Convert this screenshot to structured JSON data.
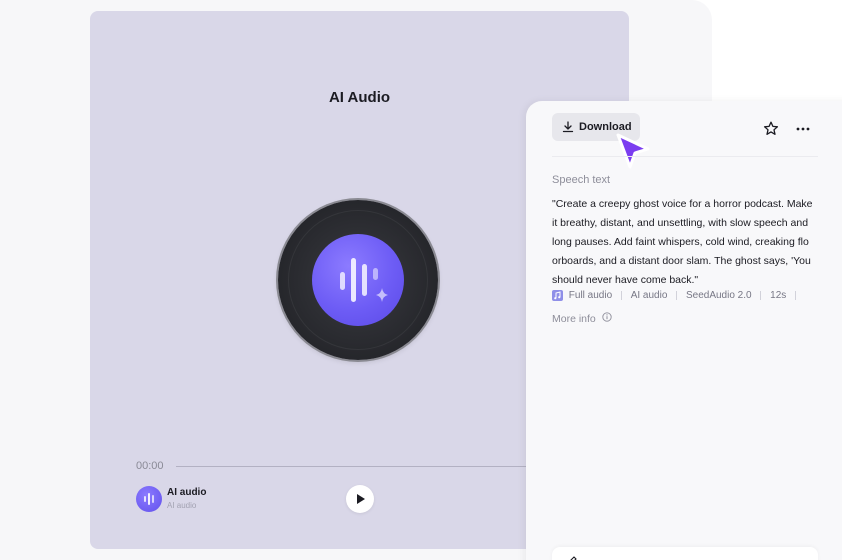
{
  "player": {
    "title": "AI Audio",
    "time_current": "00:00",
    "track": {
      "name": "AI audio",
      "subtitle": "AI audio"
    },
    "progress": 0
  },
  "details": {
    "download_label": "Download",
    "speech_section_label": "Speech text",
    "speech_text": "\"Create a creepy ghost voice for a horror podcast. Make it breathy, distant, and unsettling, with slow speech and long pauses. Add faint whispers, cold wind, creaking flo orboards, and a distant door slam. The ghost says, 'You should never have come back.\"",
    "meta": {
      "mode": "Full audio",
      "type": "AI audio",
      "model": "SeedAudio 2.0",
      "duration": "12s"
    },
    "more_info_label": "More info"
  },
  "colors": {
    "accent": "#6d5cf5",
    "player_bg": "#d9d7e8",
    "panel_bg": "#f8f8fa",
    "cursor": "#7b3df0"
  },
  "icons": {
    "download": "download-icon",
    "star": "star-icon",
    "more": "more-horizontal-icon",
    "play": "play-icon",
    "info": "info-icon",
    "waveform": "waveform-sparkle-icon",
    "cursor": "pointer-cursor-icon"
  }
}
